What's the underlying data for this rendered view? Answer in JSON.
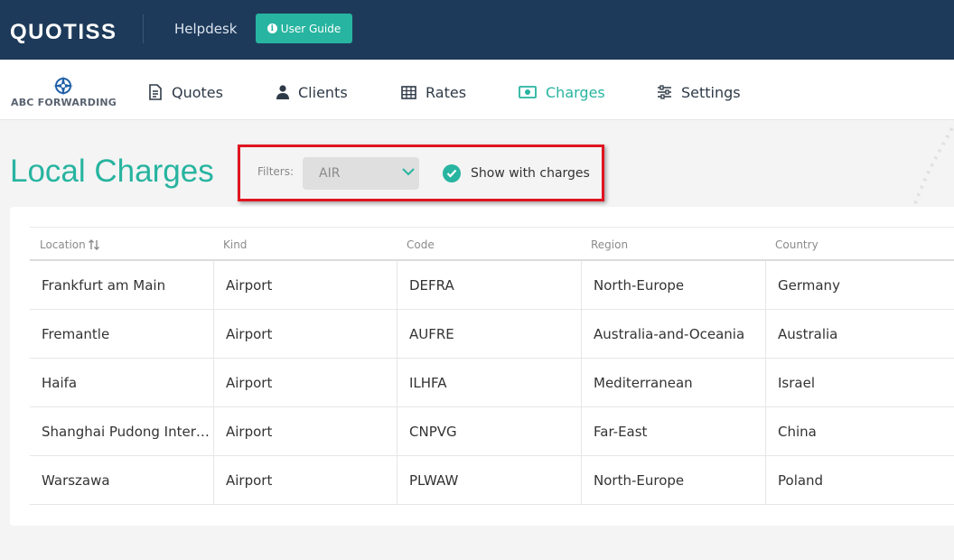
{
  "topbar": {
    "logo": "QUOTISS",
    "helpdesk": "Helpdesk",
    "user_guide": "User Guide"
  },
  "company": {
    "name": "ABC FORWARDING"
  },
  "nav": {
    "items": [
      {
        "label": "Quotes",
        "icon": "document-icon"
      },
      {
        "label": "Clients",
        "icon": "user-icon"
      },
      {
        "label": "Rates",
        "icon": "table-icon"
      },
      {
        "label": "Charges",
        "icon": "money-icon",
        "active": true
      },
      {
        "label": "Settings",
        "icon": "sliders-icon"
      }
    ]
  },
  "page": {
    "title": "Local Charges",
    "filters_label": "Filters:",
    "filter_value": "AIR",
    "show_with_charges": "Show with charges"
  },
  "table": {
    "columns": [
      "Location",
      "Kind",
      "Code",
      "Region",
      "Country"
    ],
    "rows": [
      [
        "Frankfurt am Main",
        "Airport",
        "DEFRA",
        "North-Europe",
        "Germany"
      ],
      [
        "Fremantle",
        "Airport",
        "AUFRE",
        "Australia-and-Oceania",
        "Australia"
      ],
      [
        "Haifa",
        "Airport",
        "ILHFA",
        "Mediterranean",
        "Israel"
      ],
      [
        "Shanghai Pudong Inter…",
        "Airport",
        "CNPVG",
        "Far-East",
        "China"
      ],
      [
        "Warszawa",
        "Airport",
        "PLWAW",
        "North-Europe",
        "Poland"
      ]
    ]
  },
  "colors": {
    "topbar": "#1e3a5a",
    "accent": "#27b4a0",
    "highlight": "#e0151f"
  }
}
